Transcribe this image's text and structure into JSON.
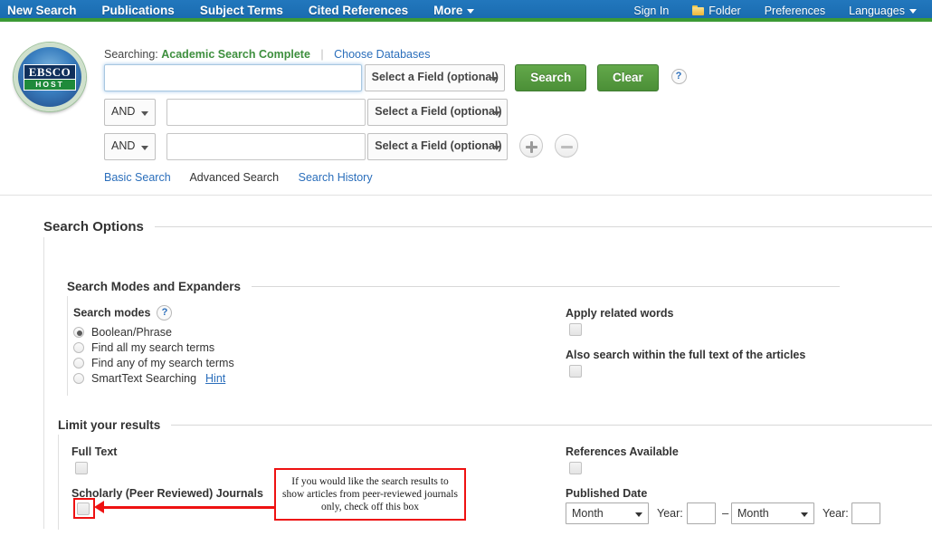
{
  "topnav": {
    "left_items": [
      {
        "label": "New Search",
        "icon": null,
        "caret": false
      },
      {
        "label": "Publications",
        "icon": null,
        "caret": false
      },
      {
        "label": "Subject Terms",
        "icon": null,
        "caret": false
      },
      {
        "label": "Cited References",
        "icon": null,
        "caret": false
      },
      {
        "label": "More",
        "icon": null,
        "caret": true
      }
    ],
    "right_items": [
      {
        "label": "Sign In",
        "icon": null,
        "caret": false
      },
      {
        "label": "Folder",
        "icon": "folder-icon",
        "caret": false
      },
      {
        "label": "Preferences",
        "icon": null,
        "caret": false
      },
      {
        "label": "Languages",
        "icon": null,
        "caret": true
      }
    ]
  },
  "logo": {
    "line1": "EBSCO",
    "line2": "HOST"
  },
  "searching": {
    "prefix": "Searching:",
    "database": "Academic Search Complete",
    "choose_databases": "Choose Databases"
  },
  "search_rows": [
    {
      "boolean": null,
      "term_value": "",
      "term_placeholder": "",
      "field_label": "Select a Field (optional)"
    },
    {
      "boolean": "AND",
      "term_value": "",
      "term_placeholder": "",
      "field_label": "Select a Field (optional)"
    },
    {
      "boolean": "AND",
      "term_value": "",
      "term_placeholder": "",
      "field_label": "Select a Field (optional)"
    }
  ],
  "buttons": {
    "search": "Search",
    "clear": "Clear",
    "help": "?",
    "add_row": "+",
    "remove_row": "−"
  },
  "mode_links": [
    {
      "label": "Basic Search",
      "current": false
    },
    {
      "label": "Advanced Search",
      "current": true
    },
    {
      "label": "Search History",
      "current": false
    }
  ],
  "search_options": {
    "legend": "Search Options",
    "modes_section": {
      "legend": "Search Modes and Expanders",
      "modes_title": "Search modes",
      "modes_help": "?",
      "radios": [
        {
          "label": "Boolean/Phrase",
          "selected": true
        },
        {
          "label": "Find all my search terms",
          "selected": false
        },
        {
          "label": "Find any of my search terms",
          "selected": false
        },
        {
          "label": "SmartText Searching",
          "selected": false,
          "hint": "Hint"
        }
      ],
      "expanders": [
        {
          "label": "Apply related words",
          "checked": false
        },
        {
          "label": "Also search within the full text of the articles",
          "checked": false
        }
      ]
    },
    "limit_section": {
      "legend": "Limit your results",
      "left_limiters": [
        {
          "label": "Full Text",
          "checked": false
        },
        {
          "label": "Scholarly (Peer Reviewed) Journals",
          "checked": false
        }
      ],
      "right_limiters": [
        {
          "label": "References Available",
          "checked": false
        }
      ],
      "published_date": {
        "label": "Published Date",
        "from_month": "Month",
        "from_year_label": "Year:",
        "from_year_value": "",
        "dash": "–",
        "to_month": "Month",
        "to_year_label": "Year:",
        "to_year_value": ""
      }
    }
  },
  "annotation": {
    "text": "If you would like the search results to show articles from peer-reviewed journals only, check off this box",
    "color": "#ee1111"
  },
  "colors": {
    "nav_blue": "#1d6fb8",
    "nav_green_strip": "#3c9a35",
    "button_green": "#4b8f37",
    "link_blue": "#2a6ebb",
    "database_green": "#3e8f3e",
    "annotation_red": "#ee1111"
  }
}
